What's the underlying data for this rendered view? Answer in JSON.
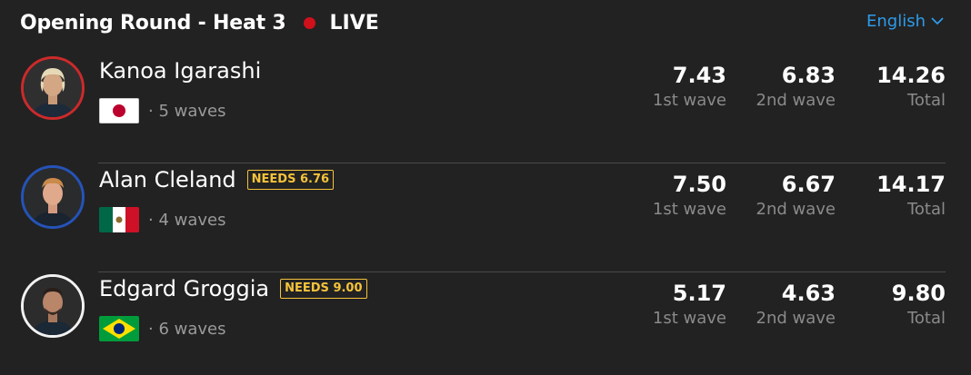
{
  "header": {
    "title": "Opening Round - Heat 3",
    "live_label": "LIVE",
    "live_color": "#d0101a",
    "language": "English",
    "language_icon": "chevron-down-icon"
  },
  "surfers": [
    {
      "name": "Kanoa Igarashi",
      "needs": null,
      "country_flag": "japan-flag",
      "waves": "· 5 waves",
      "ring_color": "#cc2a2a",
      "wave1": "7.43",
      "wave1_label": "1st wave",
      "wave2": "6.83",
      "wave2_label": "2nd wave",
      "total": "14.26",
      "total_label": "Total"
    },
    {
      "name": "Alan Cleland",
      "needs": "NEEDS 6.76",
      "country_flag": "mexico-flag",
      "waves": "· 4 waves",
      "ring_color": "#2553b8",
      "wave1": "7.50",
      "wave1_label": "1st wave",
      "wave2": "6.67",
      "wave2_label": "2nd wave",
      "total": "14.17",
      "total_label": "Total"
    },
    {
      "name": "Edgard Groggia",
      "needs": "NEEDS 9.00",
      "country_flag": "brazil-flag",
      "waves": "· 6 waves",
      "ring_color": "#f2f2f2",
      "wave1": "5.17",
      "wave1_label": "1st wave",
      "wave2": "4.63",
      "wave2_label": "2nd wave",
      "total": "9.80",
      "total_label": "Total"
    }
  ]
}
